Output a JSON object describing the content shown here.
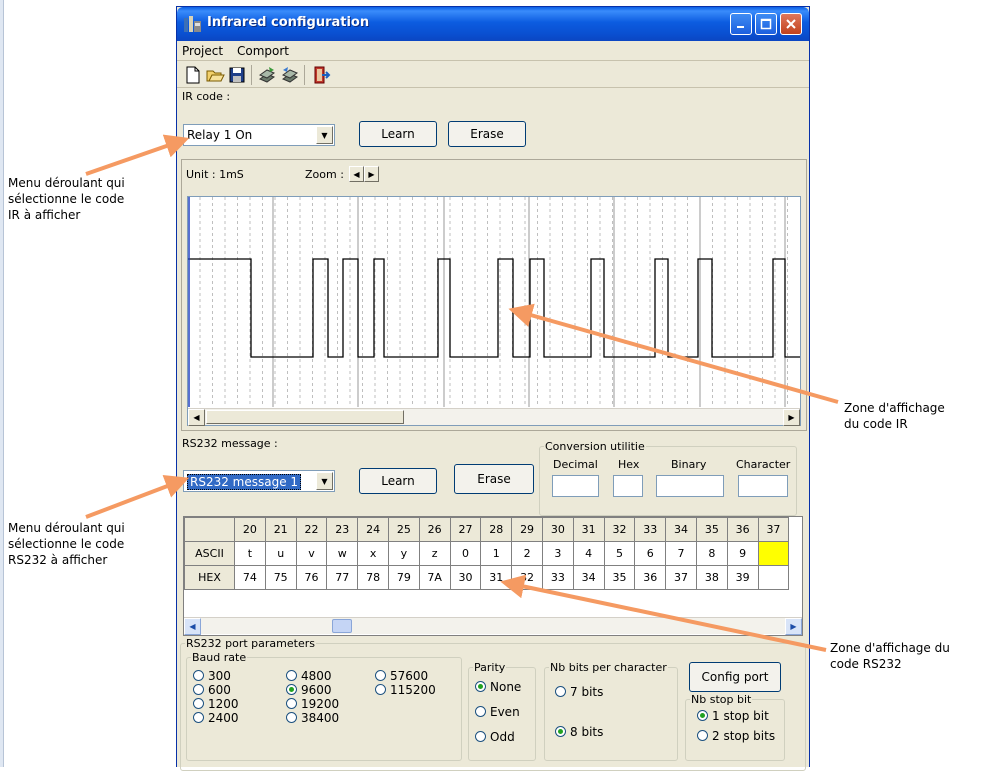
{
  "window": {
    "title": "Infrared configuration",
    "menu": [
      "Project",
      "Comport"
    ]
  },
  "toolbar": {
    "icons": [
      "new-file-icon",
      "open-folder-icon",
      "save-icon",
      "send-icon",
      "receive-icon",
      "exit-icon"
    ]
  },
  "ir": {
    "section_label": "IR code :",
    "selected_code": "Relay 1 On",
    "learn_label": "Learn",
    "erase_label": "Erase",
    "unit_label": "Unit : 1mS",
    "zoom_label": "Zoom :"
  },
  "rs232": {
    "section_label": "RS232 message :",
    "selected_message": "RS232 message 1",
    "learn_label": "Learn",
    "erase_label": "Erase",
    "conversion": {
      "title": "Conversion utilitie",
      "decimal": "Decimal",
      "hex": "Hex",
      "binary": "Binary",
      "character": "Character"
    },
    "table": {
      "columns": [
        "20",
        "21",
        "22",
        "23",
        "24",
        "25",
        "26",
        "27",
        "28",
        "29",
        "30",
        "31",
        "32",
        "33",
        "34",
        "35",
        "36",
        "37"
      ],
      "ascii_label": "ASCII",
      "ascii": [
        "t",
        "u",
        "v",
        "w",
        "x",
        "y",
        "z",
        "0",
        "1",
        "2",
        "3",
        "4",
        "5",
        "6",
        "7",
        "8",
        "9",
        ""
      ],
      "hex_label": "HEX",
      "hex": [
        "74",
        "75",
        "76",
        "77",
        "78",
        "79",
        "7A",
        "30",
        "31",
        "32",
        "33",
        "34",
        "35",
        "36",
        "37",
        "38",
        "39",
        ""
      ]
    }
  },
  "port": {
    "title": "RS232 port parameters",
    "baud_title": "Baud rate",
    "baud_rates": [
      "300",
      "600",
      "1200",
      "2400",
      "4800",
      "9600",
      "19200",
      "38400",
      "57600",
      "115200"
    ],
    "baud_selected": "9600",
    "parity_title": "Parity",
    "parity_options": [
      "None",
      "Even",
      "Odd"
    ],
    "parity_selected": "None",
    "bits_title": "Nb bits per character",
    "bits_options": [
      "7 bits",
      "8 bits"
    ],
    "bits_selected": "8 bits",
    "config_label": "Config port",
    "stop_title": "Nb stop bit",
    "stop_options": [
      "1 stop bit",
      "2 stop bits"
    ],
    "stop_selected": "1 stop bit"
  },
  "annotations": {
    "ir_menu": [
      "Menu déroulant qui",
      "sélectionne le code",
      "IR à afficher"
    ],
    "rs232_menu": [
      "Menu déroulant qui",
      "sélectionne le code",
      "RS232 à afficher"
    ],
    "ir_zone": [
      "Zone d'affichage",
      "du code IR"
    ],
    "rs232_zone": [
      "Zone d'affichage du",
      "code RS232"
    ]
  },
  "colors": {
    "title_blue": "#0a4fd0",
    "window_face": "#ece9d8",
    "arrow_orange": "#f59a62",
    "highlight_yellow": "#ffff00",
    "selection_blue": "#316ac5"
  }
}
